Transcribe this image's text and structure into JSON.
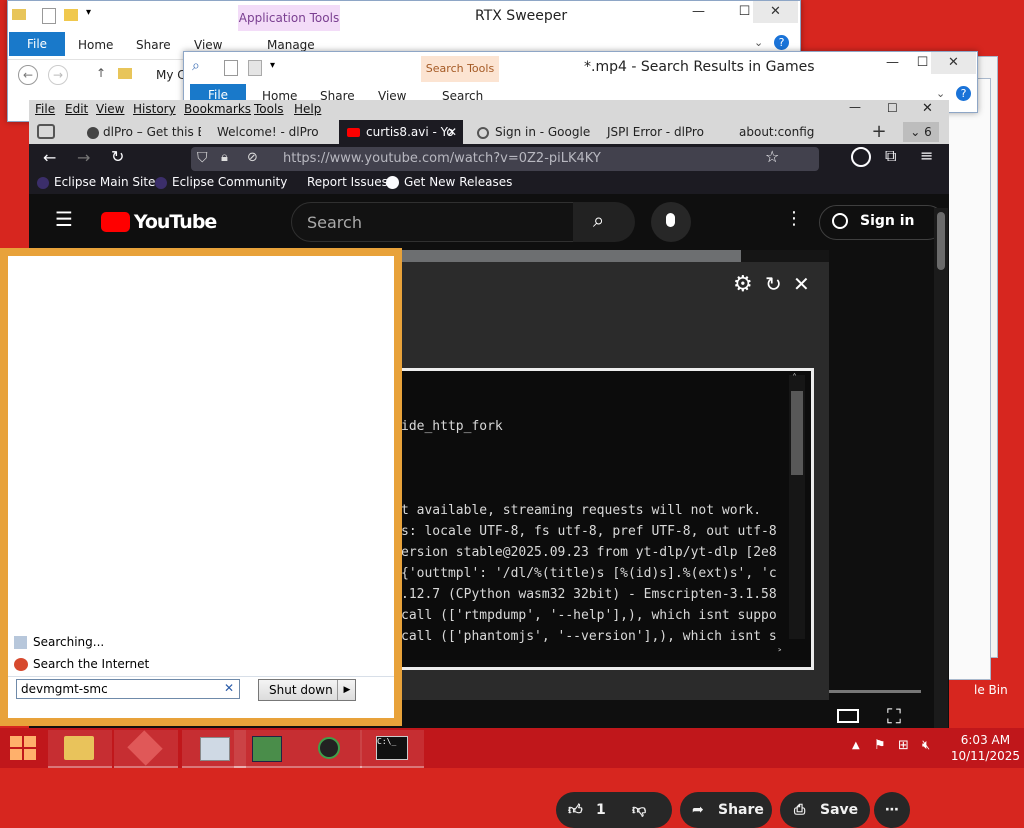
{
  "explorer_back": {
    "title": "RTX Sweeper",
    "context_header": "Application Tools",
    "ribbon": {
      "file": "File",
      "home": "Home",
      "share": "Share",
      "view": "View",
      "manage": "Manage"
    },
    "address": "My C"
  },
  "explorer_front": {
    "title": "*.mp4 - Search Results in Games",
    "context_header": "Search Tools",
    "ribbon": {
      "file": "File",
      "home": "Home",
      "share": "Share",
      "view": "View",
      "search": "Search"
    }
  },
  "firefox": {
    "menu": [
      "File",
      "Edit",
      "View",
      "History",
      "Bookmarks",
      "Tools",
      "Help"
    ],
    "tabs": [
      {
        "label": "dlPro – Get this E"
      },
      {
        "label": "Welcome! - dlPro"
      },
      {
        "label": "curtis8.avi - Yo"
      },
      {
        "label": "Sign in - Google"
      },
      {
        "label": "JSPI Error - dlPro"
      },
      {
        "label": "about:config"
      }
    ],
    "tab_count": "6",
    "url": "https://www.youtube.com/watch?v=0Z2-piLK4KY",
    "bookmarks": [
      "Eclipse Main Site",
      "Eclipse Community",
      "Report Issues",
      "Get New Releases"
    ]
  },
  "youtube": {
    "logo_text": "YouTube",
    "search_placeholder": "Search",
    "sign_in": "Sign in",
    "like_count": "1",
    "share": "Share",
    "save": "Save"
  },
  "terminal": {
    "lines": [
      "ide_http_fork",
      "t available, streaming requests will not work.",
      "s: locale UTF-8, fs utf-8, pref UTF-8, out utf-8",
      "ersion stable@2025.09.23 from yt-dlp/yt-dlp [2e8",
      "{'outtmpl': '/dl/%(title)s [%(id)s].%(ext)s', 'c",
      ".12.7 (CPython wasm32 32bit) - Emscripten-3.1.58",
      "call (['rtmpdump', '--help'],), which isnt suppo",
      "call (['phantomjs', '--version'],), which isnt s"
    ]
  },
  "start_menu": {
    "results": [
      "Searching...",
      "Search the Internet"
    ],
    "search_value": "devmgmt-smc",
    "shutdown": "Shut down"
  },
  "desktop": {
    "recycle_label": "le Bin"
  },
  "taskbar": {
    "time": "6:03 AM",
    "date": "10/11/2025"
  },
  "colors": {
    "desktop": "#d7261f",
    "taskbar": "#c0171b",
    "start_border": "#e8a23a",
    "yt_red": "#ff0000",
    "ribbon_file": "#1979ca"
  }
}
